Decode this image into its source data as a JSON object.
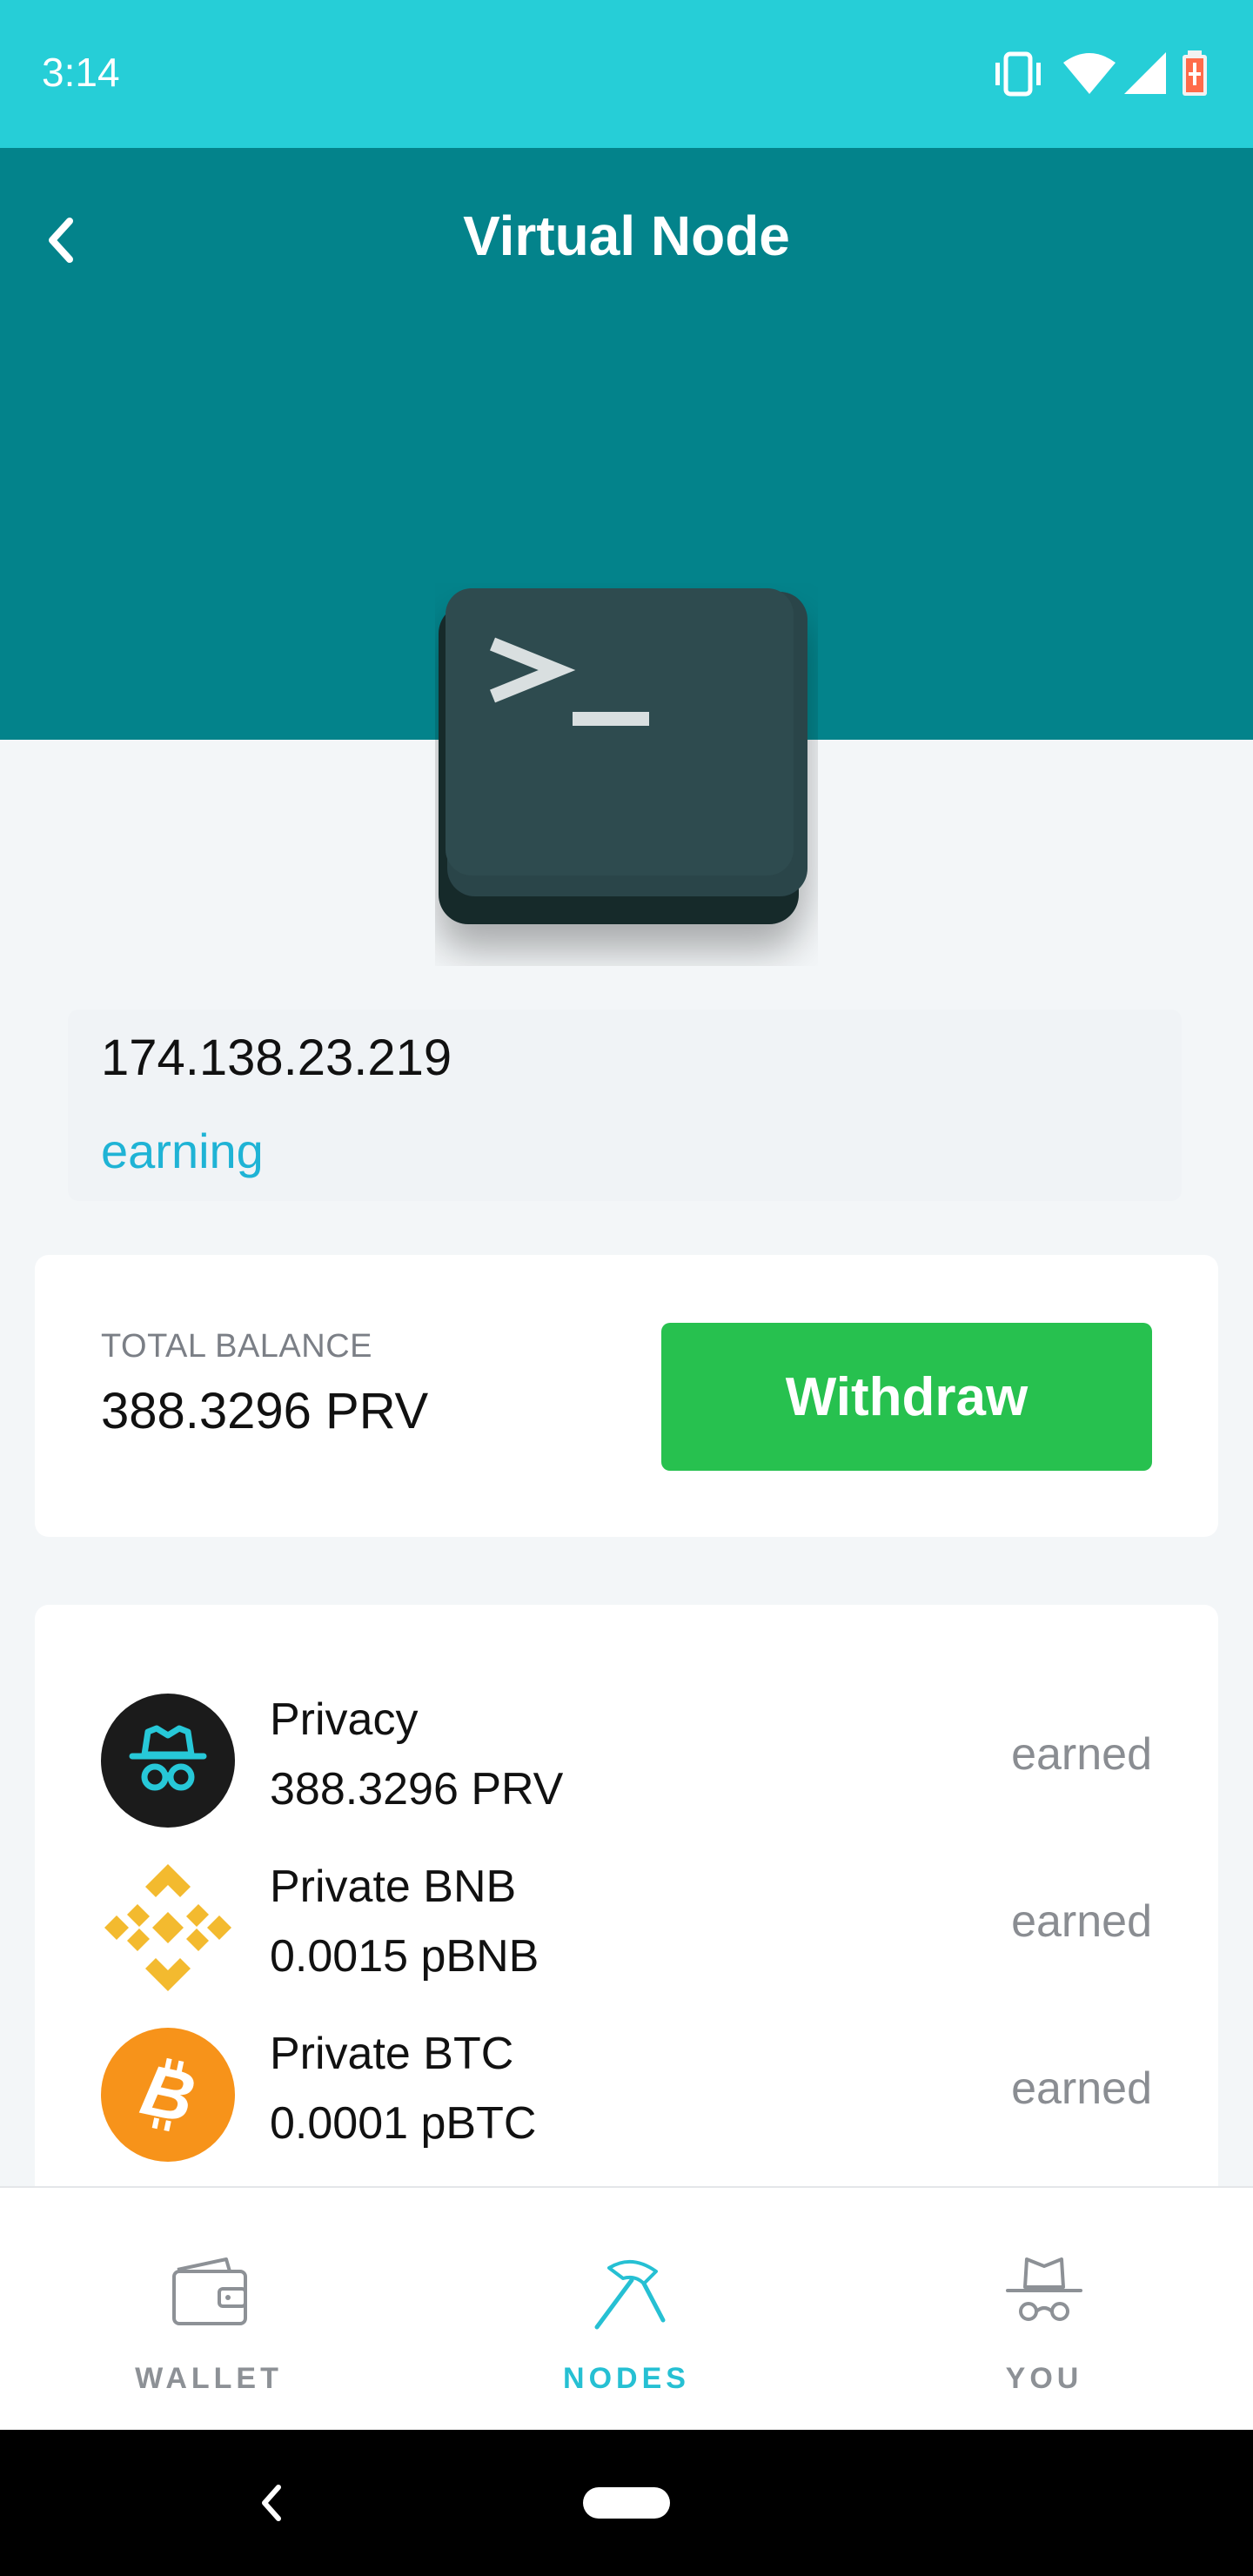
{
  "status_bar": {
    "time": "3:14",
    "icons": [
      "vibrate-icon",
      "wifi-icon",
      "signal-icon",
      "battery-icon"
    ]
  },
  "header": {
    "title": "Virtual Node",
    "back_icon": "chevron-left-icon"
  },
  "node": {
    "icon": "terminal-icon",
    "ip": "174.138.23.219",
    "status": "earning"
  },
  "balance": {
    "label": "TOTAL BALANCE",
    "value": "388.3296 PRV",
    "withdraw_label": "Withdraw"
  },
  "rewards": [
    {
      "name": "Privacy",
      "amount": "388.3296 PRV",
      "status": "earned",
      "icon": "privacy-coin-icon"
    },
    {
      "name": "Private BNB",
      "amount": "0.0015 pBNB",
      "status": "earned",
      "icon": "bnb-icon"
    },
    {
      "name": "Private BTC",
      "amount": "0.0001 pBTC",
      "status": "earned",
      "icon": "bitcoin-icon"
    }
  ],
  "bottom_nav": {
    "tabs": [
      {
        "label": "WALLET",
        "icon": "wallet-icon",
        "active": false
      },
      {
        "label": "NODES",
        "icon": "pickaxe-icon",
        "active": true
      },
      {
        "label": "YOU",
        "icon": "incognito-icon",
        "active": false
      }
    ]
  },
  "colors": {
    "status_bar": "#26ced7",
    "header": "#03838b",
    "accent": "#26c0d3",
    "withdraw": "#27c14f",
    "earning": "#1fb3d5"
  }
}
